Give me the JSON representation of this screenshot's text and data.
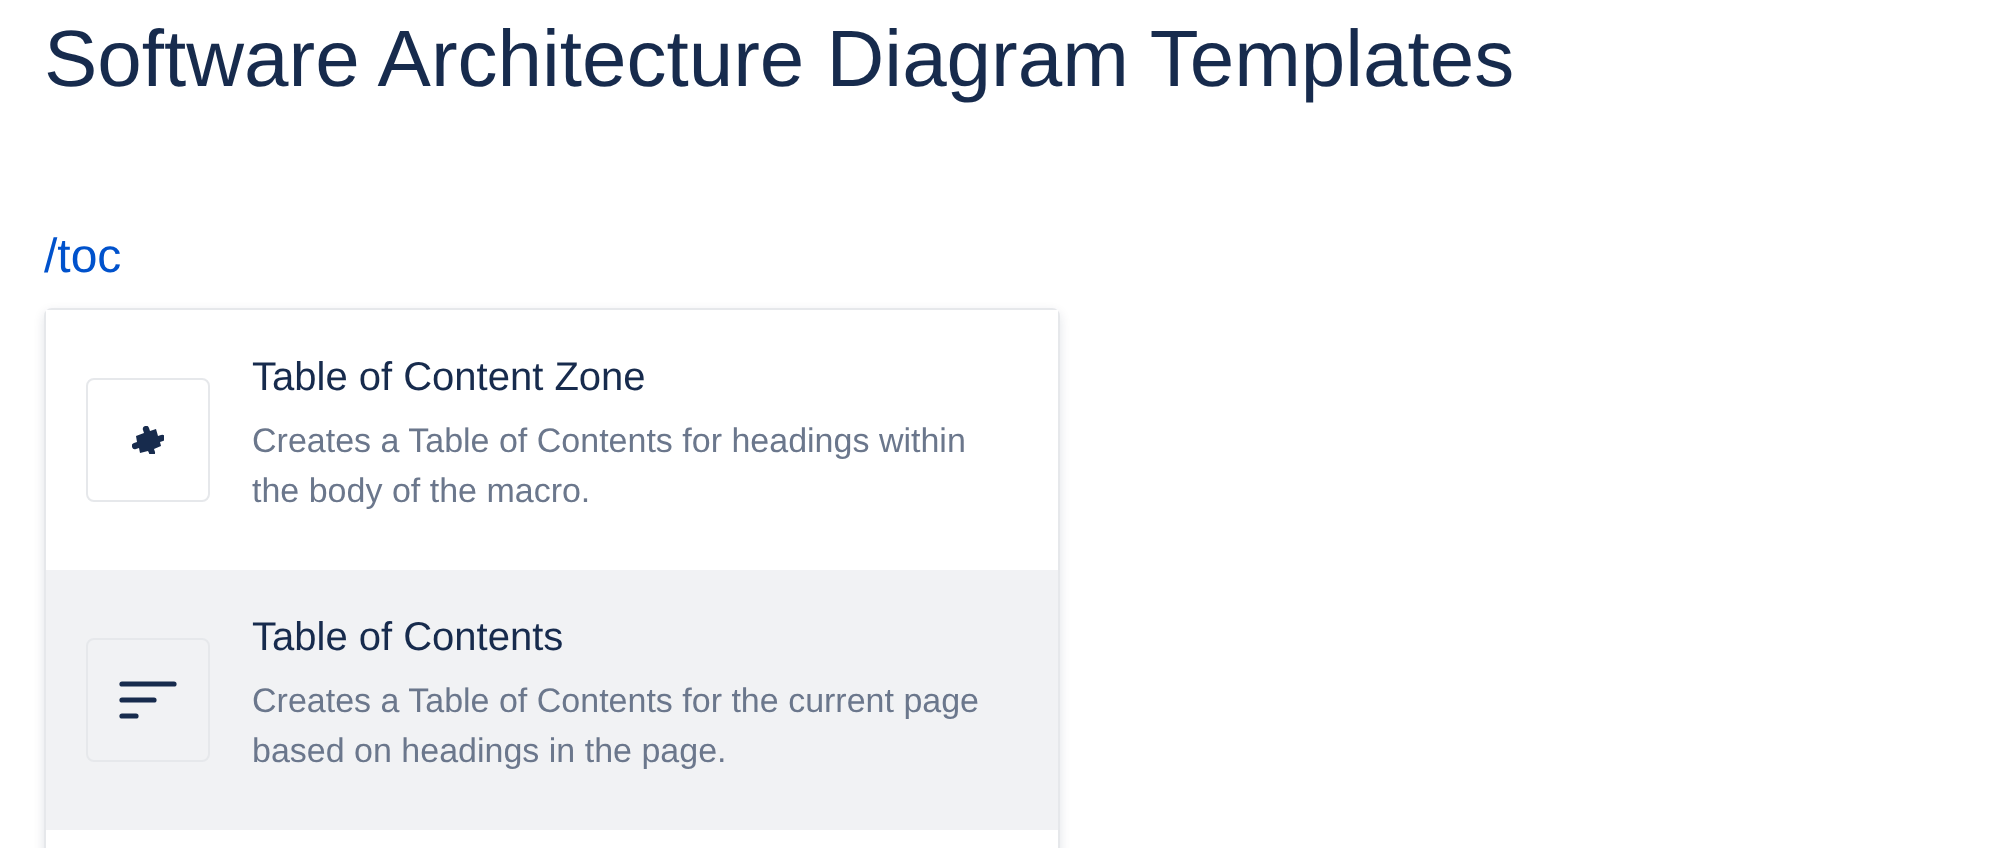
{
  "page": {
    "title": "Software Architecture Diagram Templates"
  },
  "editor": {
    "typed_command": "/toc"
  },
  "menu": {
    "items": [
      {
        "kind": "puzzle",
        "title": "Table of Content Zone",
        "description": "Creates a Table of Contents for headings within the body of the macro.",
        "selected": false
      },
      {
        "kind": "lines",
        "title": "Table of Contents",
        "description": "Creates a Table of Contents for the current page based on headings in the page.",
        "selected": true
      }
    ]
  }
}
